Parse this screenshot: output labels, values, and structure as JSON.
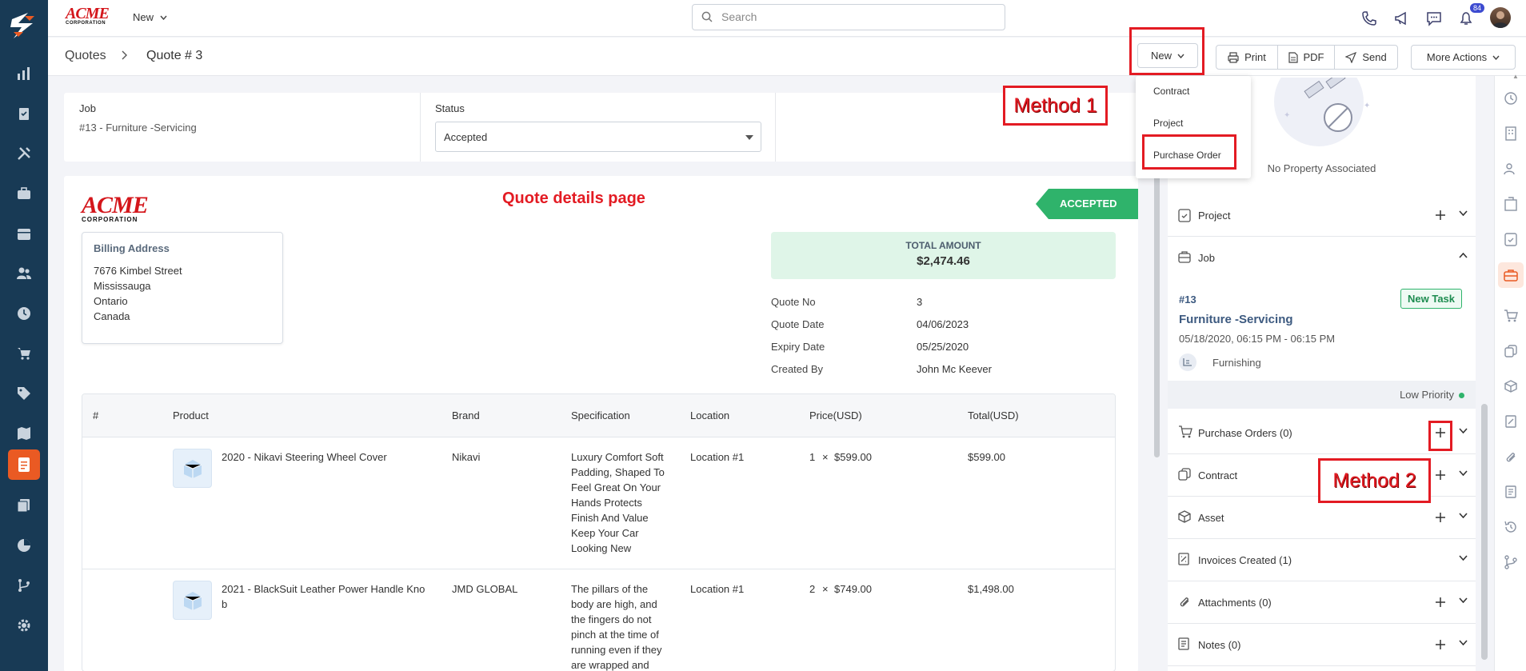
{
  "topbar": {
    "brand_top": "ACME",
    "brand_bottom": "CORPORATION",
    "new_label": "New",
    "search_placeholder": "Search",
    "notif_count": "84"
  },
  "subbar": {
    "breadcrumb_root": "Quotes",
    "breadcrumb_current": "Quote # 3",
    "new_btn": "New",
    "print_btn": "Print",
    "pdf_btn": "PDF",
    "send_btn": "Send",
    "more_btn": "More Actions"
  },
  "dropdown": {
    "items": [
      "Contract",
      "Project",
      "Purchase Order"
    ]
  },
  "annotations": {
    "method1": "Method 1",
    "method2": "Method 2",
    "page_note": "Quote details page"
  },
  "job": {
    "label": "Job",
    "value": "#13 - Furniture -Servicing",
    "status_label": "Status",
    "status_value": "Accepted"
  },
  "quote": {
    "status_ribbon": "ACCEPTED",
    "billing_title": "Billing Address",
    "billing_lines": [
      "7676 Kimbel Street",
      "Mississauga",
      "Ontario",
      "Canada"
    ],
    "total_label": "TOTAL AMOUNT",
    "total_value": "$2,474.46",
    "details": [
      {
        "k": "Quote No",
        "v": "3"
      },
      {
        "k": "Quote Date",
        "v": "04/06/2023"
      },
      {
        "k": "Expiry Date",
        "v": "05/25/2020"
      },
      {
        "k": "Created By",
        "v": "John Mc Keever"
      }
    ]
  },
  "table": {
    "headers": [
      "#",
      "Product",
      "Brand",
      "Specification",
      "Location",
      "Price(USD)",
      "Total(USD)"
    ],
    "rows": [
      {
        "product": "2020 - Nikavi Steering Wheel Cover",
        "brand": "Nikavi",
        "spec": [
          "Luxury Comfort Soft",
          "Padding, Shaped To",
          "Feel Great On Your",
          "Hands Protects",
          "Finish And Value",
          "Keep Your Car",
          "Looking New"
        ],
        "location": "Location #1",
        "qty": "1",
        "price": "$599.00",
        "total": "$599.00"
      },
      {
        "product": [
          "2021 - BlackSuit Leather Power Handle Kno",
          "b"
        ],
        "brand": "JMD GLOBAL",
        "spec": [
          "The pillars of the",
          "body are high, and",
          "the fingers do not",
          "pinch at the time of",
          "running even if they",
          "are wrapped and"
        ],
        "location": "Location #1",
        "qty": "2",
        "price": "$749.00",
        "total": "$1,498.00"
      }
    ]
  },
  "right": {
    "no_property": "No Property Associated",
    "project": "Project",
    "job": "Job",
    "job_number": "#13",
    "job_badge": "New Task",
    "job_title": "Furniture -Servicing",
    "job_time": "05/18/2020, 06:15 PM - 06:15 PM",
    "job_category": "Furnishing",
    "priority": "Low Priority",
    "purchase_orders": "Purchase Orders (0)",
    "contract": "Contract",
    "asset": "Asset",
    "invoices": "Invoices Created (1)",
    "attachments": "Attachments (0)",
    "notes": "Notes (0)"
  },
  "colors": {
    "sidebar": "#183a55",
    "accent": "#ea5a23",
    "accepted": "#2fb36b",
    "annotation": "#e31b23",
    "link": "#3d5a80"
  }
}
